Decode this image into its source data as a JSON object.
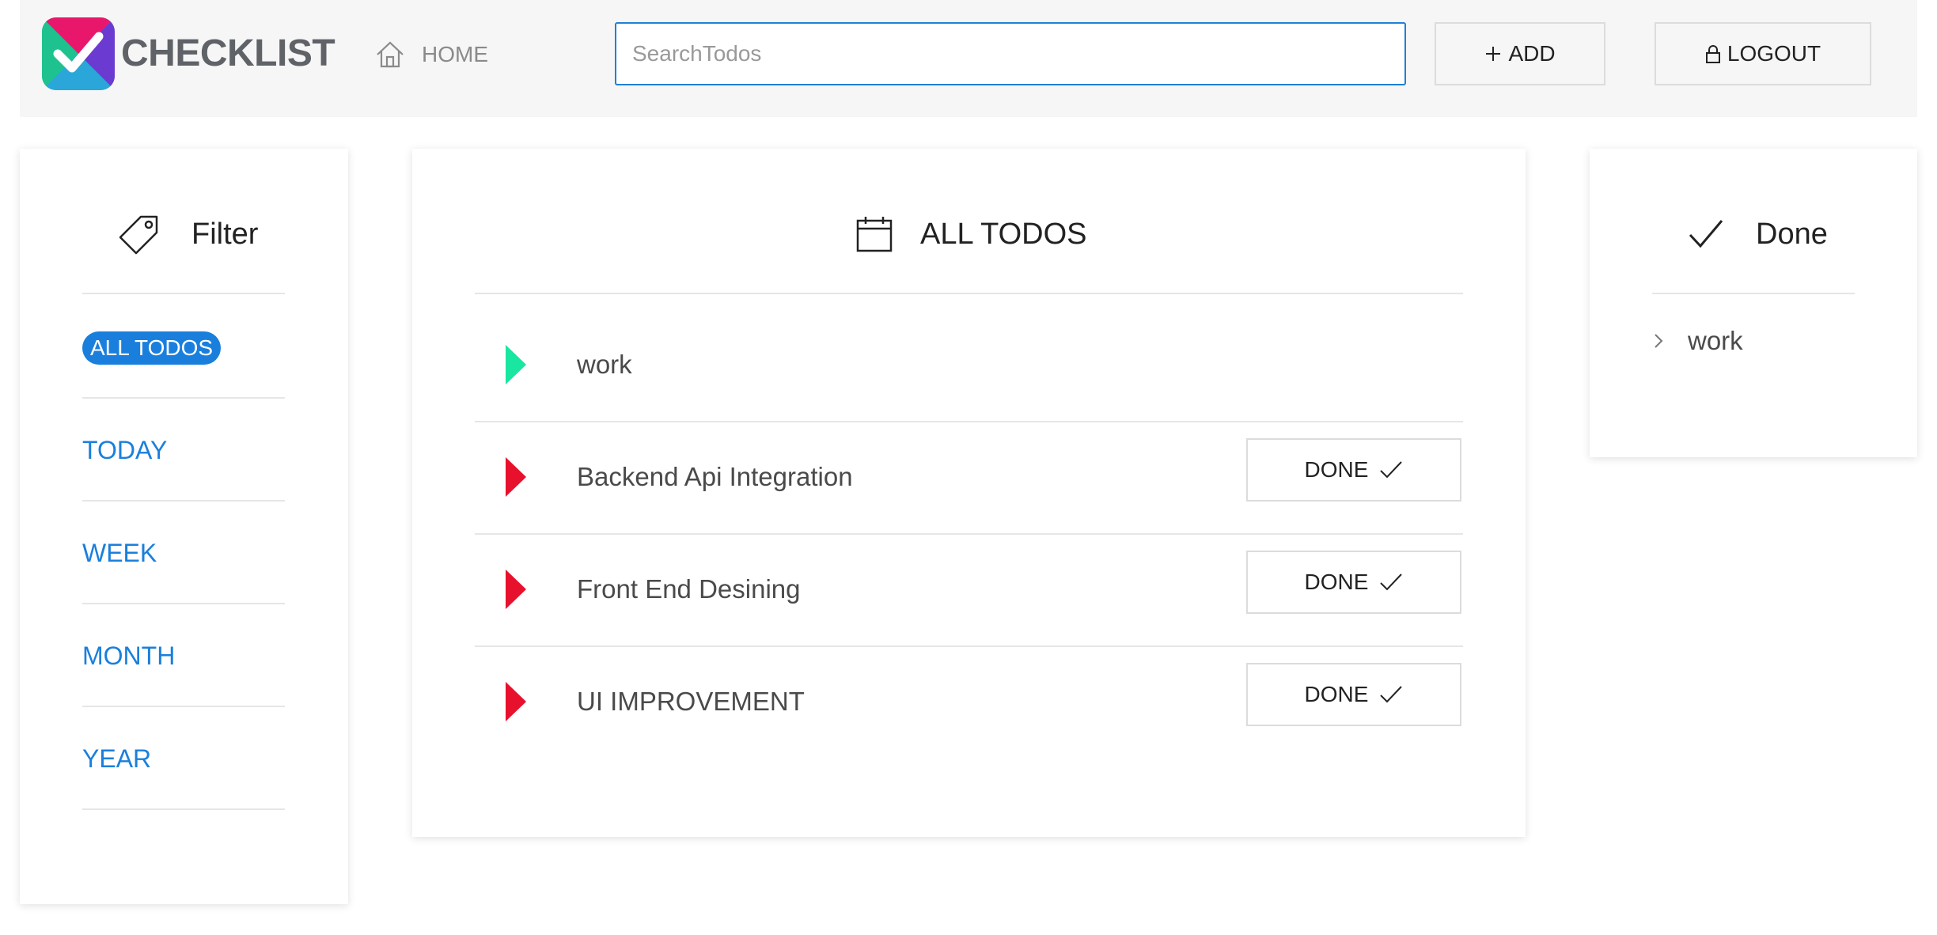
{
  "header": {
    "brand": "CHECKLIST",
    "logo_icon": "checkmark-logo-icon",
    "home_label": "HOME",
    "home_icon": "home-icon",
    "search_placeholder": "SearchTodos",
    "search_value": "",
    "add_label": "ADD",
    "add_icon": "plus-icon",
    "logout_label": "LOGOUT",
    "logout_icon": "lock-icon"
  },
  "filter": {
    "title": "Filter",
    "icon": "tag-icon",
    "items": [
      {
        "label": "ALL TODOS",
        "active": true
      },
      {
        "label": "TODAY",
        "active": false
      },
      {
        "label": "WEEK",
        "active": false
      },
      {
        "label": "MONTH",
        "active": false
      },
      {
        "label": "YEAR",
        "active": false
      }
    ]
  },
  "todos": {
    "title": "ALL TODOS",
    "icon": "calendar-icon",
    "group_label": "work",
    "done_button_label": "DONE",
    "items": [
      {
        "text": "Backend Api Integration"
      },
      {
        "text": "Front End Desining"
      },
      {
        "text": "UI IMPROVEMENT"
      }
    ]
  },
  "done": {
    "title": "Done",
    "icon": "check-icon",
    "items": [
      {
        "text": "work"
      }
    ]
  },
  "colors": {
    "accent": "#1a7fdc",
    "group_marker": "#19e6a0",
    "todo_marker": "#e8112d",
    "header_bg": "#f6f6f6"
  }
}
